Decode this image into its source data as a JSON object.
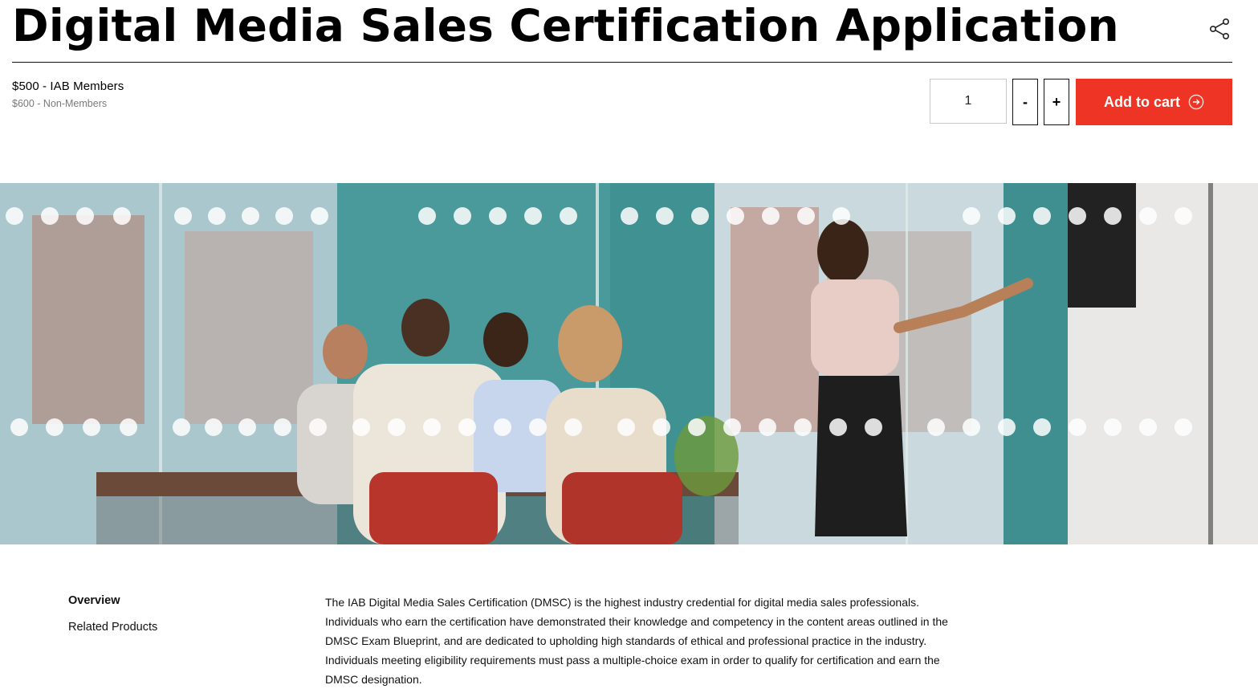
{
  "product": {
    "title": "Digital Media Sales Certification Application",
    "price_members": "$500 - IAB Members",
    "price_nonmembers": "$600 - Non-Members"
  },
  "cart": {
    "quantity": "1",
    "decrement_label": "-",
    "increment_label": "+",
    "add_label": "Add to cart"
  },
  "icons": {
    "share": "share-icon",
    "cart_arrow": "arrow-circle-right-icon"
  },
  "colors": {
    "accent": "#ee3424",
    "text": "#000000",
    "muted": "#7a7a7a"
  },
  "nav": {
    "items": [
      {
        "label": "Overview",
        "active": true
      },
      {
        "label": "Related Products",
        "active": false
      }
    ]
  },
  "overview": {
    "text": "The IAB Digital Media Sales Certification (DMSC) is the highest industry credential for digital media sales professionals. Individuals who earn the certification have demonstrated their knowledge and competency in the content areas outlined in the DMSC Exam Blueprint, and are dedicated to upholding high standards of ethical and professional practice in the industry. Individuals meeting eligibility requirements must pass a multiple-choice exam in order to qualify for certification and earn the DMSC designation."
  }
}
